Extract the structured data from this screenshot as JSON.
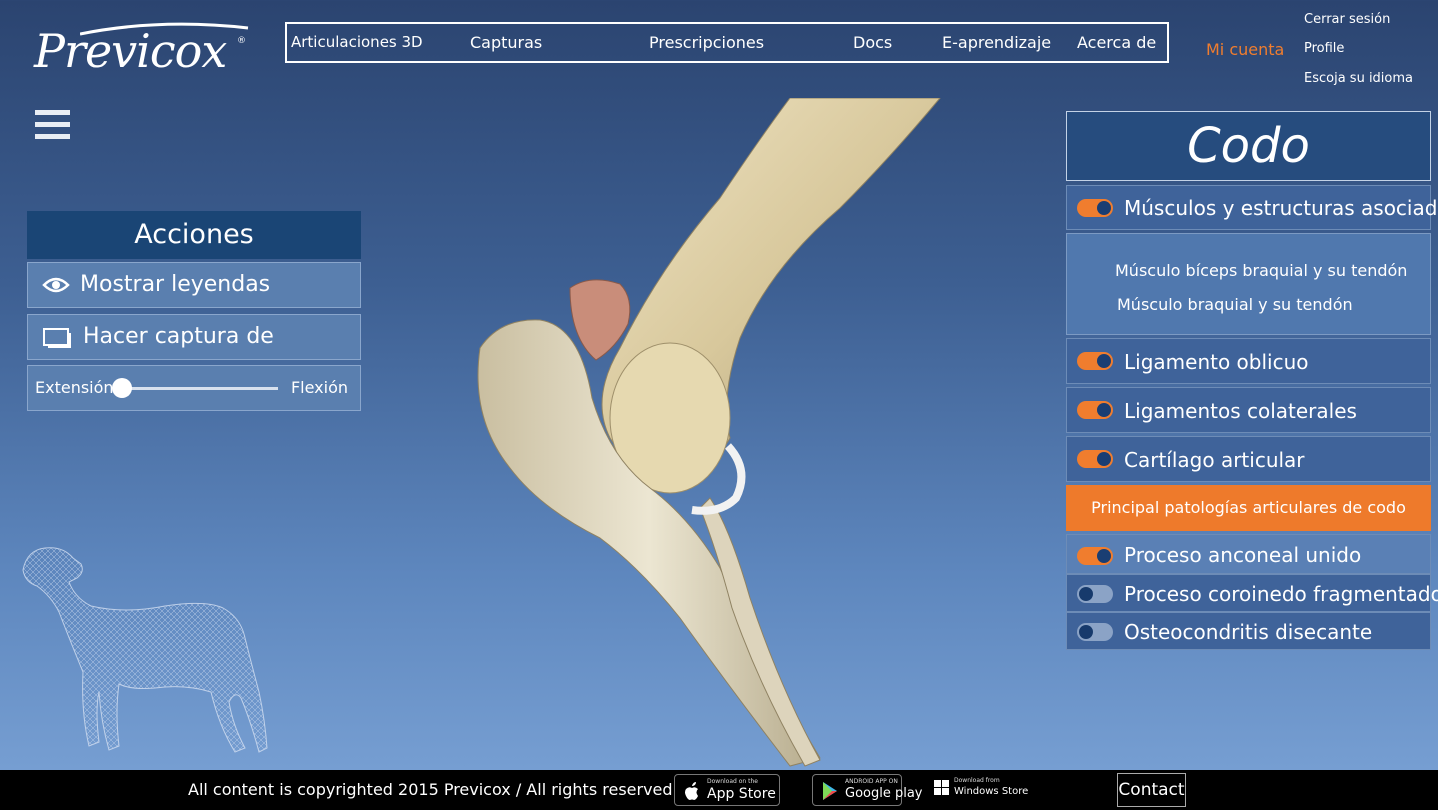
{
  "header": {
    "logo_text": "Previcox",
    "logo_reg": "®",
    "nav": [
      "Articulaciones 3D",
      "Capturas",
      "Prescripciones",
      "Docs",
      "E-aprendizaje",
      "Acerca de"
    ],
    "account_label": "Mi cuenta",
    "account_links": [
      "Cerrar sesión",
      "Profile",
      "Escoja su idioma"
    ]
  },
  "actions": {
    "title": "Acciones",
    "show_legends": "Mostrar leyendas",
    "screenshot": "Hacer captura de pantalla",
    "slider_left": "Extensión",
    "slider_right": "Flexión",
    "slider_value": 0
  },
  "panel": {
    "title": "Codo",
    "musculos": {
      "label": "Músculos y estructuras asociadas",
      "on": true
    },
    "sub_items": [
      "Músculo bíceps braquial y su tendón",
      "Músculo braquial y su tendón"
    ],
    "ligamento_oblicuo": {
      "label": "Ligamento oblicuo",
      "on": true
    },
    "ligamentos_colaterales": {
      "label": "Ligamentos colaterales",
      "on": true
    },
    "cartilago": {
      "label": "Cartílago articular",
      "on": true
    },
    "patologias_label": "Principal patologías articulares de codo",
    "proceso_anconeal": {
      "label": "Proceso anconeal unido",
      "on": true
    },
    "proceso_coroinedo": {
      "label": "Proceso coroinedo fragmentado",
      "on": false
    },
    "osteocondritis": {
      "label": "Osteocondritis disecante",
      "on": false
    }
  },
  "footer": {
    "copyright": "All content is copyrighted 2015 Previcox / All rights reserved",
    "app_store_small": "Download on the",
    "app_store_big": "App Store",
    "google_small": "ANDROID APP ON",
    "google_big": "Google play",
    "windows_small": "Download from",
    "windows_big": "Windows Store",
    "contact": "Contact"
  },
  "colors": {
    "accent": "#f07d2e",
    "panel_dark": "#1a4575",
    "panel_mid": "#3f639a"
  }
}
